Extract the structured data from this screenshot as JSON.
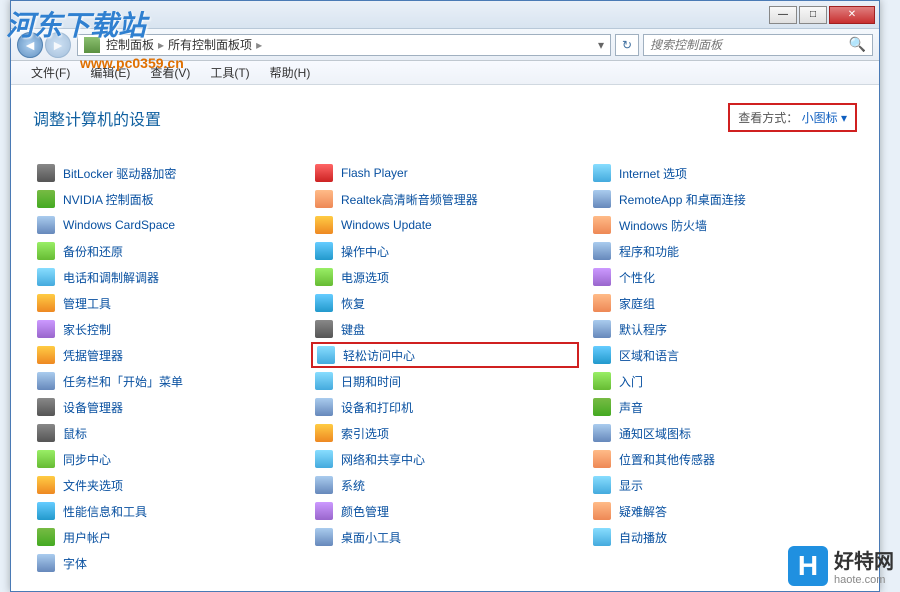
{
  "window": {
    "min": "—",
    "max": "□",
    "close": "✕"
  },
  "nav": {
    "back": "◄",
    "fwd": "►"
  },
  "breadcrumb": {
    "root": "控制面板",
    "current": "所有控制面板项",
    "sep": "▸",
    "drop": "▾"
  },
  "refresh": "↻",
  "search": {
    "placeholder": "搜索控制面板",
    "icon": "🔍"
  },
  "menus": {
    "file": "文件(F)",
    "edit": "编辑(E)",
    "view": "查看(V)",
    "tools": "工具(T)",
    "help": "帮助(H)"
  },
  "header": {
    "title": "调整计算机的设置",
    "view_label": "查看方式：",
    "view_value": "小图标 ▾"
  },
  "items": {
    "c0": [
      {
        "l": "BitLocker 驱动器加密",
        "i": 0
      },
      {
        "l": "Flash Player",
        "i": 4
      },
      {
        "l": "Internet 选项",
        "i": 9
      }
    ],
    "c1": [
      {
        "l": "NVIDIA 控制面板",
        "i": 1
      },
      {
        "l": "Realtek高清晰音频管理器",
        "i": 8
      },
      {
        "l": "RemoteApp 和桌面连接",
        "i": 6
      }
    ],
    "c2": [
      {
        "l": "Windows CardSpace",
        "i": 6
      },
      {
        "l": "Windows Update",
        "i": 3
      },
      {
        "l": "Windows 防火墙",
        "i": 8
      }
    ],
    "c3": [
      {
        "l": "备份和还原",
        "i": 7
      },
      {
        "l": "操作中心",
        "i": 2
      },
      {
        "l": "程序和功能",
        "i": 6
      }
    ],
    "c4": [
      {
        "l": "电话和调制解调器",
        "i": 9
      },
      {
        "l": "电源选项",
        "i": 7
      },
      {
        "l": "个性化",
        "i": 5
      }
    ],
    "c5": [
      {
        "l": "管理工具",
        "i": 3
      },
      {
        "l": "恢复",
        "i": 2
      },
      {
        "l": "家庭组",
        "i": 8
      }
    ],
    "c6": [
      {
        "l": "家长控制",
        "i": 5
      },
      {
        "l": "键盘",
        "i": 0
      },
      {
        "l": "默认程序",
        "i": 6
      }
    ],
    "c7": [
      {
        "l": "凭据管理器",
        "i": 3
      },
      {
        "l": "轻松访问中心",
        "i": 9,
        "hl": true
      },
      {
        "l": "区域和语言",
        "i": 2
      }
    ],
    "c8": [
      {
        "l": "任务栏和「开始」菜单",
        "i": 6
      },
      {
        "l": "日期和时间",
        "i": 9
      },
      {
        "l": "入门",
        "i": 7
      }
    ],
    "c9": [
      {
        "l": "设备管理器",
        "i": 0
      },
      {
        "l": "设备和打印机",
        "i": 6
      },
      {
        "l": "声音",
        "i": 1
      }
    ],
    "c10": [
      {
        "l": "鼠标",
        "i": 0
      },
      {
        "l": "索引选项",
        "i": 3
      },
      {
        "l": "通知区域图标",
        "i": 6
      }
    ],
    "c11": [
      {
        "l": "同步中心",
        "i": 7
      },
      {
        "l": "网络和共享中心",
        "i": 9
      },
      {
        "l": "位置和其他传感器",
        "i": 8
      }
    ],
    "c12": [
      {
        "l": "文件夹选项",
        "i": 3
      },
      {
        "l": "系统",
        "i": 6
      },
      {
        "l": "显示",
        "i": 9
      }
    ],
    "c13": [
      {
        "l": "性能信息和工具",
        "i": 2
      },
      {
        "l": "颜色管理",
        "i": 5
      },
      {
        "l": "疑难解答",
        "i": 8
      }
    ],
    "c14": [
      {
        "l": "用户帐户",
        "i": 1
      },
      {
        "l": "桌面小工具",
        "i": 6
      },
      {
        "l": "自动播放",
        "i": 9
      }
    ],
    "c15": [
      {
        "l": "字体",
        "i": 6
      }
    ]
  },
  "watermarks": {
    "logo": "河东下载站",
    "url": "www.pc0359.cn",
    "haote_cn": "好特网",
    "haote_en": "haote.com",
    "haote_icon": "H"
  }
}
